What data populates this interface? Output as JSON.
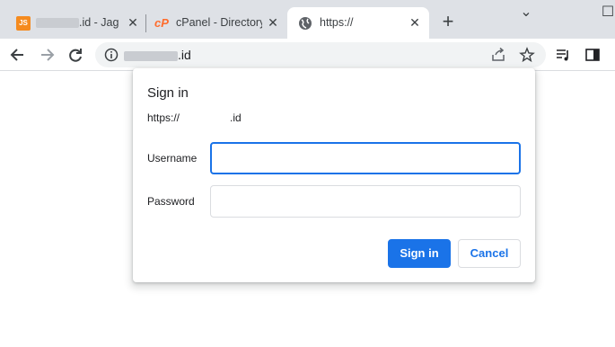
{
  "tabs": [
    {
      "title_visible": ".id - Jag",
      "active": false,
      "favicon": "orange-site-icon"
    },
    {
      "title_visible": "cPanel - Directory",
      "active": false,
      "favicon": "cpanel-icon"
    },
    {
      "title_visible": "https://",
      "active": true,
      "favicon": "globe-icon"
    }
  ],
  "tab_close_glyph": "✕",
  "new_tab_glyph": "+",
  "window_controls": {
    "minimize_glyph": "⌄",
    "maximize_glyph": "☐"
  },
  "omnibox": {
    "url_suffix": ".id"
  },
  "dialog": {
    "title": "Sign in",
    "origin_prefix": "https://",
    "origin_suffix": ".id",
    "username_label": "Username",
    "username_value": "",
    "password_label": "Password",
    "password_value": "",
    "sign_in_label": "Sign in",
    "cancel_label": "Cancel"
  },
  "colors": {
    "accent": "#1a73e8",
    "tabstrip": "#dee1e6",
    "omnibox": "#f1f3f4"
  }
}
